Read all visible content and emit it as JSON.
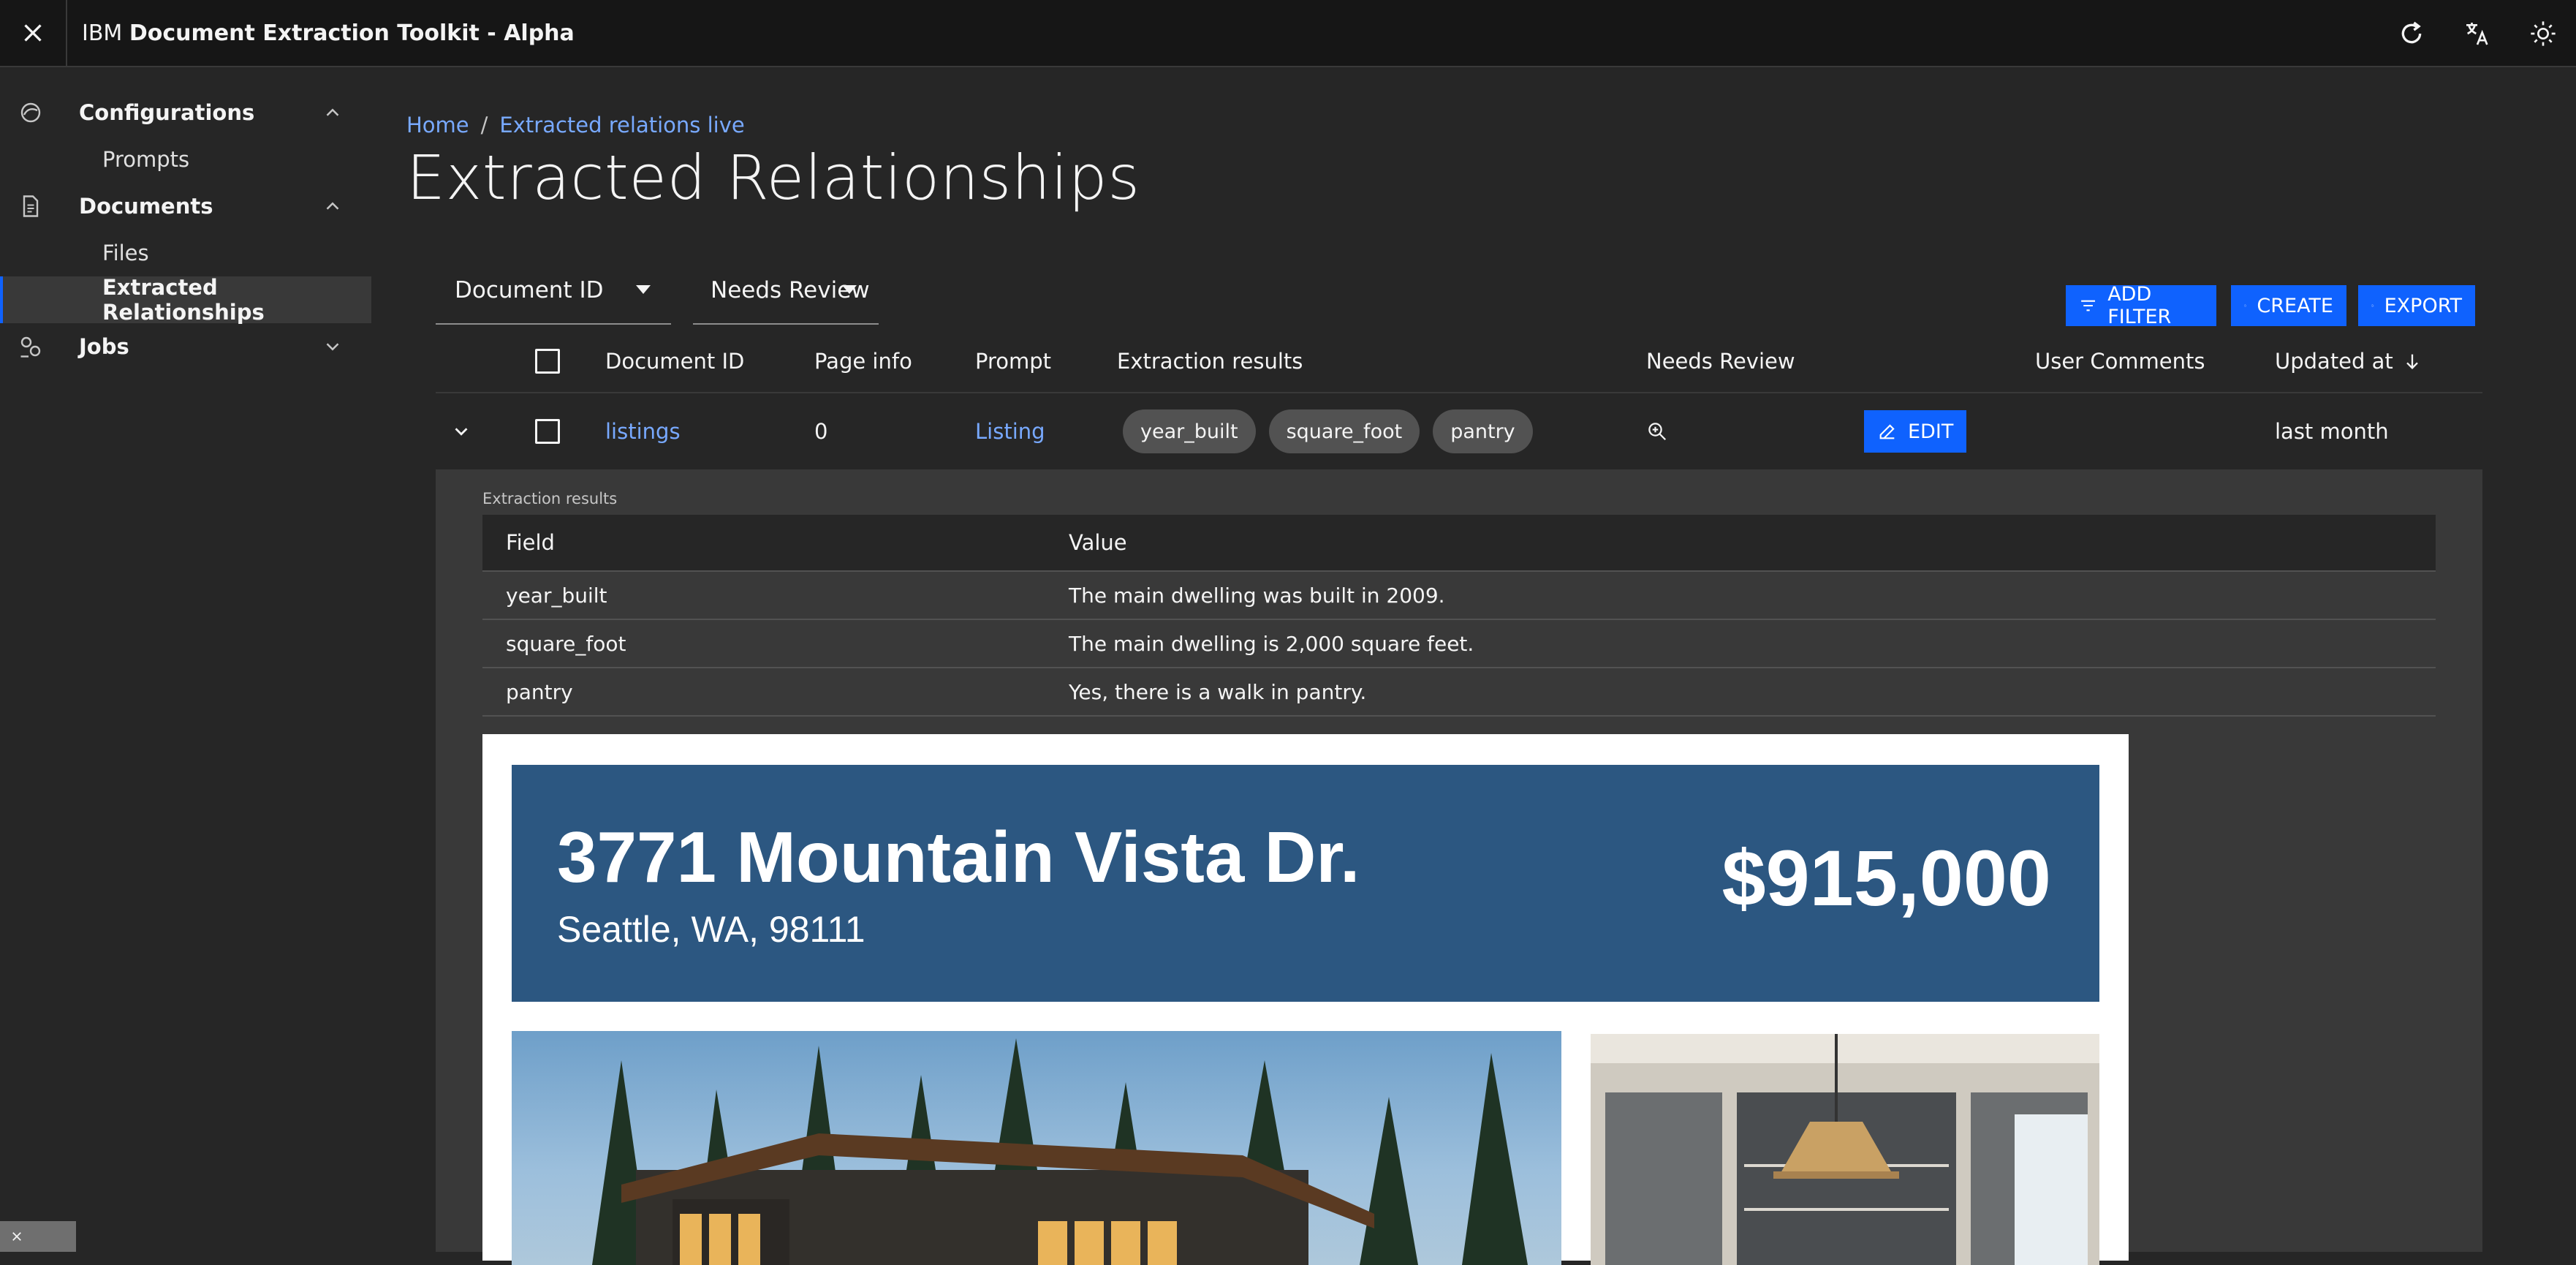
{
  "app": {
    "prefix": "IBM",
    "name": "Document Extraction Toolkit - Alpha"
  },
  "header_icons": [
    "refresh-icon",
    "translate-icon",
    "theme-icon"
  ],
  "sidebar": {
    "items": [
      {
        "label": "Configurations",
        "type": "section",
        "icon": "configurations-icon",
        "expanded": true
      },
      {
        "label": "Prompts",
        "type": "sub"
      },
      {
        "label": "Documents",
        "type": "section",
        "icon": "document-icon",
        "expanded": true
      },
      {
        "label": "Files",
        "type": "sub"
      },
      {
        "label": "Extracted Relationships",
        "type": "sub",
        "active": true
      },
      {
        "label": "Jobs",
        "type": "section",
        "icon": "jobs-icon",
        "expanded": false
      }
    ]
  },
  "breadcrumb": {
    "home": "Home",
    "separator": "/",
    "current": "Extracted relations live"
  },
  "page_title": "Extracted Relationships",
  "filters": {
    "document_id": "Document ID",
    "needs_review": "Needs Review"
  },
  "actions": {
    "add_filter": "ADD FILTER",
    "create": "CREATE",
    "export": "EXPORT"
  },
  "table": {
    "headers": {
      "document_id": "Document ID",
      "page_info": "Page info",
      "prompt": "Prompt",
      "extraction_results": "Extraction results",
      "needs_review": "Needs Review",
      "user_comments": "User Comments",
      "updated_at": "Updated at"
    },
    "rows": [
      {
        "document_id": "listings",
        "page_info": "0",
        "prompt": "Listing",
        "tags": [
          "year_built",
          "square_foot",
          "pantry"
        ],
        "edit_label": "EDIT",
        "updated_at": "last month"
      }
    ]
  },
  "expanded": {
    "label": "Extraction results",
    "headers": {
      "field": "Field",
      "value": "Value"
    },
    "rows": [
      {
        "field": "year_built",
        "value": "The main dwelling was built in 2009."
      },
      {
        "field": "square_foot",
        "value": "The main dwelling is 2,000 square feet."
      },
      {
        "field": "pantry",
        "value": "Yes, there is a walk in pantry."
      }
    ]
  },
  "document_preview": {
    "address": "3771 Mountain Vista Dr.",
    "city": "Seattle, WA, 98111",
    "price": "$915,000",
    "banner_color": "#2c5781"
  },
  "colors": {
    "accent": "#0f62fe",
    "link": "#78a9ff",
    "background": "#262626",
    "header": "#161616"
  }
}
